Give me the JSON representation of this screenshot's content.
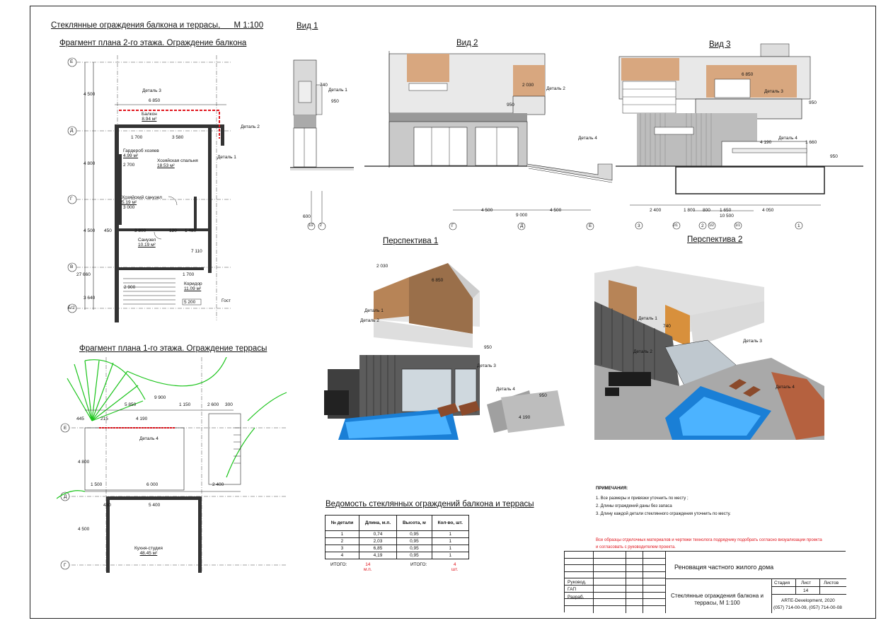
{
  "sheet": {
    "main_title": "Стеклянные ограждения балкона и террасы,",
    "main_scale": "М 1:100"
  },
  "plan2": {
    "title": "Фрагмент плана 2-го этажа. Ограждение балкона",
    "axes": [
      "Е",
      "Д",
      "Г",
      "В",
      "Б/2"
    ],
    "dims_left": [
      "4 500",
      "4 800",
      "4 500",
      "27 660",
      "3 640"
    ],
    "rooms": [
      {
        "name": "Балкон",
        "area": "8.94 м²"
      },
      {
        "name": "Гардероб хозяев",
        "area": "4.99 м²"
      },
      {
        "name": "Хозяйская спальня",
        "area": "18.53 м²"
      },
      {
        "name": "Хозяйский санузел",
        "area": "5.19 м²"
      },
      {
        "name": "Санузел",
        "area": "10.19 м²"
      },
      {
        "name": "Коридор",
        "area": "11.09 м²"
      }
    ],
    "dims": [
      "6 850",
      "1 700",
      "3 580",
      "3 800",
      "1 480",
      "1 700",
      "120",
      "450",
      "2 700",
      "3 000",
      "7 110",
      "2 900",
      "5 200"
    ],
    "callouts": [
      "Деталь 3",
      "Деталь 2",
      "Деталь 1"
    ],
    "extra": "Гост"
  },
  "plan1": {
    "title": "Фрагмент плана 1-го этажа. Ограждение террасы",
    "axes": [
      "Е",
      "Д",
      "Г"
    ],
    "dims": [
      "9 900",
      "5 850",
      "1 150",
      "2 600",
      "300",
      "445",
      "215",
      "4 190",
      "1 500",
      "6 000",
      "2 400",
      "5 400",
      "450",
      "4 500",
      "4 800"
    ],
    "callout": "Деталь 4",
    "room": {
      "name": "Кухня-студия",
      "area": "48.45 м²"
    }
  },
  "views": {
    "view1": {
      "title": "Вид 1",
      "dims": [
        "740",
        "950",
        "600"
      ],
      "callout": "Деталь 1",
      "axes": [
        "1/2",
        "2"
      ]
    },
    "view2": {
      "title": "Вид 2",
      "dims": [
        "2 030",
        "950",
        "4 500",
        "9 000",
        "4 500"
      ],
      "callouts": [
        "Деталь 2",
        "Деталь 4"
      ],
      "axes": [
        "Г",
        "Д",
        "Е"
      ]
    },
    "view3": {
      "title": "Вид 3",
      "dims": [
        "6 850",
        "950",
        "4 190",
        "1 660",
        "950",
        "2 400",
        "1 800",
        "800",
        "1 650",
        "4 050",
        "10 500"
      ],
      "callouts": [
        "Деталь 3",
        "Деталь 4"
      ],
      "axes": [
        "3",
        "2/1",
        "2",
        "1/2",
        "1/1",
        "1"
      ]
    }
  },
  "persp1": {
    "title": "Перспектива 1",
    "labels": [
      "Деталь 1",
      "Деталь 2",
      "Деталь 3",
      "Деталь 4"
    ],
    "dims": [
      "2 030",
      "6 850",
      "950",
      "4 190",
      "950"
    ]
  },
  "persp2": {
    "title": "Перспектива 2",
    "labels": [
      "Деталь 1",
      "Деталь 2",
      "Деталь 3",
      "Деталь 4"
    ],
    "dims": [
      "740"
    ]
  },
  "schedule": {
    "title": "Ведомость стеклянных ограждений балкона и террасы",
    "headers": [
      "№ детали",
      "Длина, м.п.",
      "Высота, м",
      "Кол-во, шт."
    ],
    "rows": [
      [
        "1",
        "0,74",
        "0,95",
        "1"
      ],
      [
        "2",
        "2,03",
        "0,95",
        "1"
      ],
      [
        "3",
        "6,85",
        "0,95",
        "1"
      ],
      [
        "4",
        "4,19",
        "0,95",
        "1"
      ]
    ],
    "total_label_1": "ИТОГО:",
    "total_len": "14",
    "total_len_unit": "м.п.",
    "total_label_2": "ИТОГО:",
    "total_qty": "4",
    "total_qty_unit": "шт."
  },
  "notes": {
    "heading": "ПРИМЕЧАНИЯ:",
    "items": [
      "1. Все размеры и привязки уточнить по месту ;",
      "2. Длины ограждений даны без запаса",
      "3. Длину каждой детали стеклянного ограждения уточнить по месту."
    ],
    "warning_1": "Все образцы отделочных материалов и чертежи технолога подрядчику подобрать согласно визуализации проекта",
    "warning_2": " и согласовать с руководителем проекта."
  },
  "stamp": {
    "project": "Реновация частного жилого дома",
    "roles": [
      "Руковод.",
      "ГАП",
      "Разраб."
    ],
    "sheet_title_1": "Стеклянные ограждения балкона и",
    "sheet_title_2": "террасы,          М 1:100",
    "col_stage": "Стадия",
    "col_sheet": "Лист",
    "col_sheets": "Листов",
    "sheet_no": "14",
    "company": "ARTE-Development, 2020",
    "phones": "(057) 714-00-09, (057) 714-00-08"
  },
  "colors": {
    "accent_red": "#e0141c",
    "glass_green": "#1bc41b",
    "pool_blue": "#1a7fd6",
    "wood": "#b78457"
  }
}
